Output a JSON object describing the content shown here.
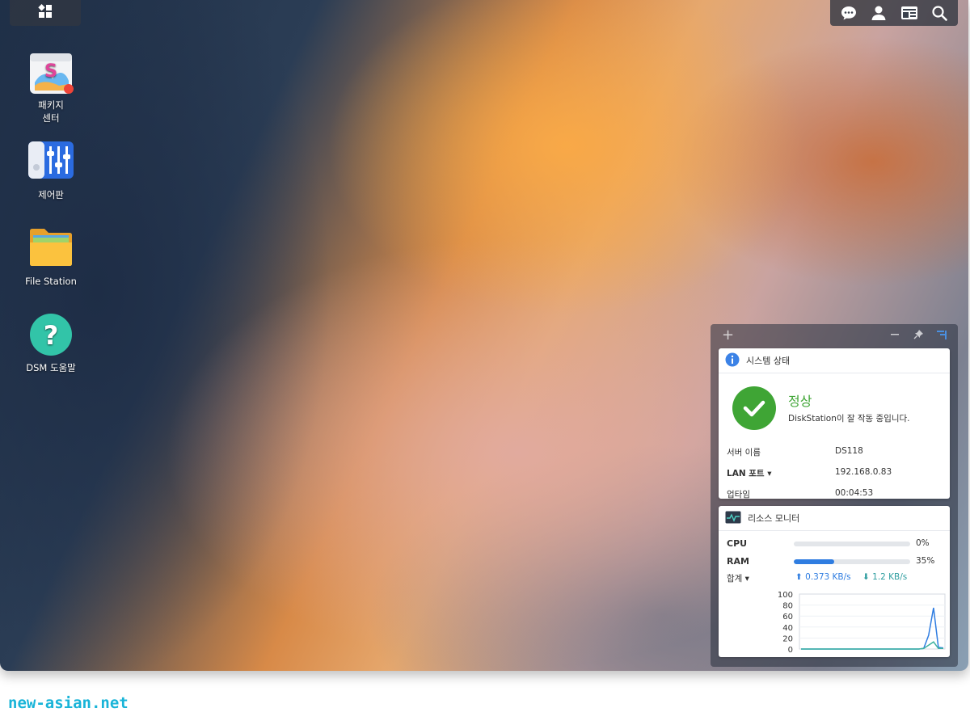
{
  "desktop": {
    "icons": [
      {
        "label_line1": "패키지",
        "label_line2": "센터",
        "icon": "package-center-icon",
        "badge": true
      },
      {
        "label_line1": "제어판",
        "icon": "control-panel-icon"
      },
      {
        "label_line1": "File Station",
        "icon": "file-station-icon"
      },
      {
        "label_line1": "DSM 도움말",
        "icon": "dsm-help-icon"
      }
    ]
  },
  "taskbar": {
    "left_icon": "main-menu-icon",
    "right_icons": [
      "chat-icon",
      "user-icon",
      "widgets-icon",
      "search-icon"
    ]
  },
  "widgets": {
    "system_status": {
      "title": "시스템 상태",
      "status": "정상",
      "message": "DiskStation이 잘 작동 중입니다.",
      "rows": [
        {
          "key": "서버 이름",
          "value": "DS118"
        },
        {
          "key": "LAN 포트 ▾",
          "value": "192.168.0.83"
        },
        {
          "key": "업타임",
          "value": "00:04:53"
        }
      ]
    },
    "resource_monitor": {
      "title": "리소스 모니터",
      "cpu_label": "CPU",
      "cpu_value": "0%",
      "cpu_fraction": 0,
      "ram_label": "RAM",
      "ram_value": "35%",
      "ram_fraction": 0.35,
      "net_label": "합계 ▾",
      "upload": "0.373 KB/s",
      "download": "1.2 KB/s"
    }
  },
  "chart_data": {
    "type": "line",
    "yticks": [
      "100",
      "80",
      "60",
      "40",
      "20",
      "0"
    ],
    "ylim": [
      0,
      100
    ],
    "series": [
      {
        "values": [
          0,
          0,
          0,
          0,
          0,
          0,
          0,
          0,
          0,
          0,
          0,
          0,
          0,
          0,
          0,
          0,
          0,
          0,
          0,
          0,
          0,
          0,
          0,
          0,
          0,
          1,
          25,
          75,
          3,
          2
        ],
        "color": "#2f7de1"
      },
      {
        "values": [
          0,
          0,
          0,
          0,
          0,
          0,
          0,
          0,
          0,
          0,
          0,
          0,
          0,
          0,
          0,
          0,
          0,
          0,
          0,
          0,
          0,
          0,
          0,
          0,
          0,
          1,
          7,
          13,
          1,
          1
        ],
        "color": "#3fb3a0"
      }
    ]
  },
  "watermark": "new-asian.net"
}
